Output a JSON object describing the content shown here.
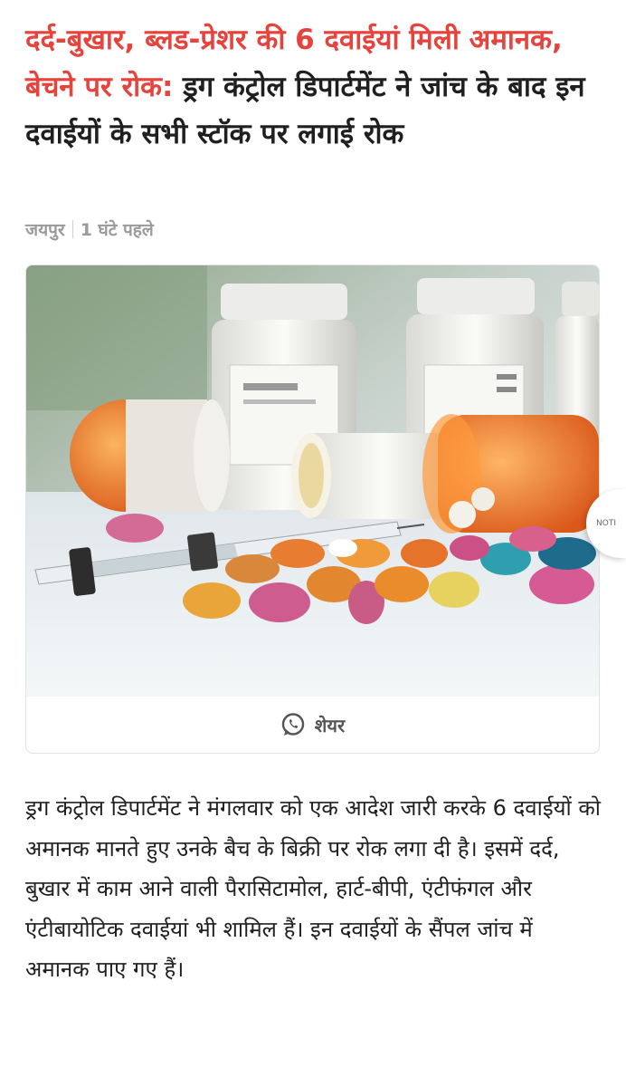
{
  "headline": {
    "kicker": "दर्द-बुखार, ब्लड-प्रेशर की 6 दवाईयां मिली अमानक, बेचने पर रोक:",
    "text": " ड्रग कंट्रोल डिपार्टमेंट ने जांच के बाद इन दवाईयों के सभी स्टॉक पर लगाई रोक"
  },
  "meta": {
    "location": "जयपुर",
    "time": "1 घंटे पहले"
  },
  "share": {
    "label": "शेयर",
    "icon": "whatsapp-icon"
  },
  "side_tab": {
    "label": "NOTI"
  },
  "article": {
    "paragraph": "ड्रग कंट्रोल डिपार्टमेंट ने मंगलवार को एक आदेश जारी करके 6 दवाईयों को अमानक मानते हुए उनके बैच के बिक्री पर रोक लगा दी है। इसमें दर्द, बुखार में काम आने वाली पैरासिटामोल, हार्ट-बीपी, एंटीफंगल और एंटीबायोटिक दवाईयां भी शामिल हैं। इन दवाईयों के सैंपल जांच में अमानक पाए गए हैं।"
  },
  "colors": {
    "kicker": "#e5433c",
    "headline": "#1f1f1f",
    "meta": "#9a9a9a"
  }
}
